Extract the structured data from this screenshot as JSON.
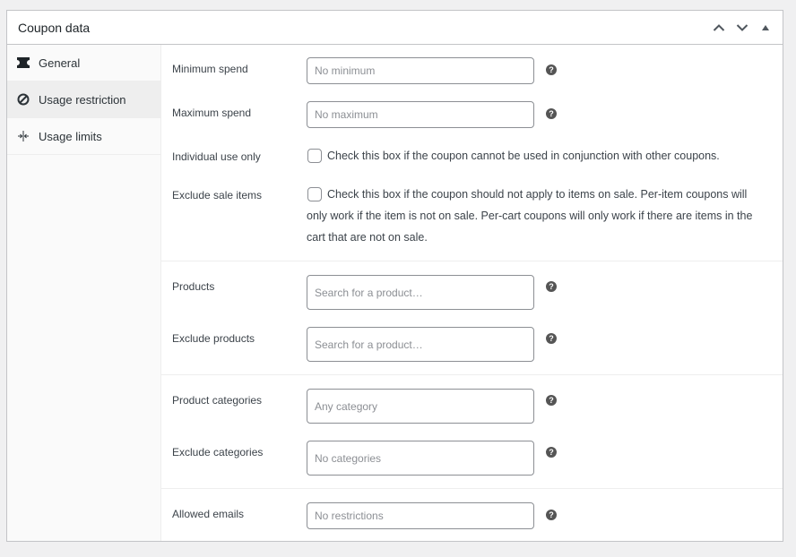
{
  "header": {
    "title": "Coupon data",
    "actions": [
      {
        "name": "move-up-icon",
        "label": "Move up"
      },
      {
        "name": "move-down-icon",
        "label": "Move down"
      },
      {
        "name": "toggle-panel-icon",
        "label": "Toggle panel"
      }
    ]
  },
  "tabs": [
    {
      "label": "General",
      "icon": "ticket-icon",
      "active": false
    },
    {
      "label": "Usage restriction",
      "icon": "blocked-icon",
      "active": true
    },
    {
      "label": "Usage limits",
      "icon": "limits-icon",
      "active": false
    }
  ],
  "fields": {
    "minimum_spend": {
      "label": "Minimum spend",
      "placeholder": "No minimum",
      "value": ""
    },
    "maximum_spend": {
      "label": "Maximum spend",
      "placeholder": "No maximum",
      "value": ""
    },
    "individual_use": {
      "label": "Individual use only",
      "checked": false,
      "description": "Check this box if the coupon cannot be used in conjunction with other coupons."
    },
    "exclude_sale_items": {
      "label": "Exclude sale items",
      "checked": false,
      "description": "Check this box if the coupon should not apply to items on sale. Per-item coupons will only work if the item is not on sale. Per-cart coupons will only work if there are items in the cart that are not on sale."
    },
    "products": {
      "label": "Products",
      "placeholder": "Search for a product…"
    },
    "exclude_products": {
      "label": "Exclude products",
      "placeholder": "Search for a product…"
    },
    "product_categories": {
      "label": "Product categories",
      "placeholder": "Any category"
    },
    "exclude_categories": {
      "label": "Exclude categories",
      "placeholder": "No categories"
    },
    "allowed_emails": {
      "label": "Allowed emails",
      "placeholder": "No restrictions",
      "value": ""
    }
  },
  "help_glyph": "?"
}
